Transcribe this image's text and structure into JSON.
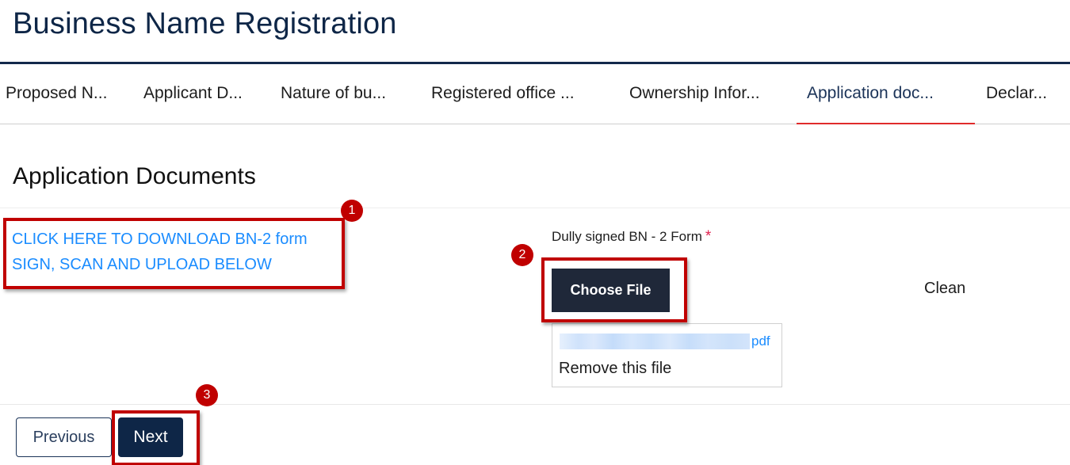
{
  "header": {
    "title": "Business Name Registration"
  },
  "tabs": [
    {
      "label": "Proposed N...",
      "active": false
    },
    {
      "label": "Applicant D...",
      "active": false
    },
    {
      "label": "Nature of bu...",
      "active": false
    },
    {
      "label": "Registered office ...",
      "active": false
    },
    {
      "label": "Ownership Infor...",
      "active": false
    },
    {
      "label": "Application doc...",
      "active": true
    },
    {
      "label": "Declar...",
      "active": false
    }
  ],
  "section": {
    "title": "Application Documents",
    "download_link_line1": "CLICK HERE TO DOWNLOAD BN-2 form",
    "download_link_line2": "SIGN, SCAN AND UPLOAD BELOW"
  },
  "upload": {
    "label": "Dully signed BN - 2 Form",
    "required_marker": "*",
    "choose_file_label": "Choose File",
    "scan_status": "Clean",
    "file_extension": "pdf",
    "remove_label": "Remove this file"
  },
  "footer": {
    "previous_label": "Previous",
    "next_label": "Next"
  },
  "annotations": [
    {
      "number": "1",
      "target": "download-link"
    },
    {
      "number": "2",
      "target": "choose-file-button"
    },
    {
      "number": "3",
      "target": "next-button"
    }
  ],
  "colors": {
    "primary_navy": "#0e2647",
    "tab_active_underline": "#e02b2b",
    "link_blue": "#1a8cff",
    "annotation_red": "#c00000",
    "choose_file_bg": "#1f2839",
    "required_star": "#e0204e"
  }
}
